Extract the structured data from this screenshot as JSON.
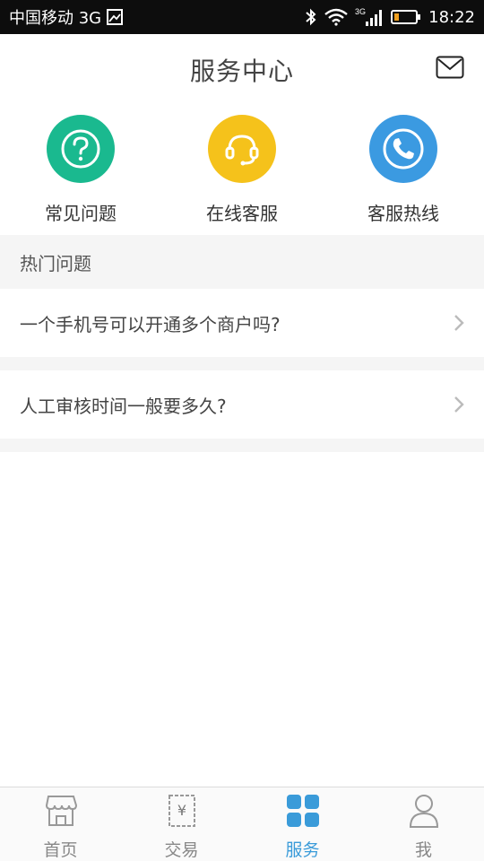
{
  "status_bar": {
    "carrier": "中国移动 3G",
    "network_badge": "3G",
    "time": "18:22",
    "icons": [
      "image-icon",
      "bluetooth-icon",
      "wifi-icon",
      "signal-icon",
      "battery-icon"
    ]
  },
  "header": {
    "title": "服务中心",
    "right_icon": "mail-icon"
  },
  "actions": [
    {
      "label": "常见问题",
      "icon": "question-icon",
      "color": "#1ab98f"
    },
    {
      "label": "在线客服",
      "icon": "headset-icon",
      "color": "#f5c21b"
    },
    {
      "label": "客服热线",
      "icon": "phone-icon",
      "color": "#3b9ae1"
    }
  ],
  "hot_questions": {
    "title": "热门问题",
    "items": [
      "一个手机号可以开通多个商户吗?",
      "人工审核时间一般要多久?"
    ]
  },
  "bottom_nav": {
    "items": [
      {
        "label": "首页",
        "icon": "store-icon",
        "active": false
      },
      {
        "label": "交易",
        "icon": "receipt-icon",
        "active": false
      },
      {
        "label": "服务",
        "icon": "grid-icon",
        "active": true
      },
      {
        "label": "我",
        "icon": "user-icon",
        "active": false
      }
    ],
    "active_color": "#3a9bd9"
  }
}
